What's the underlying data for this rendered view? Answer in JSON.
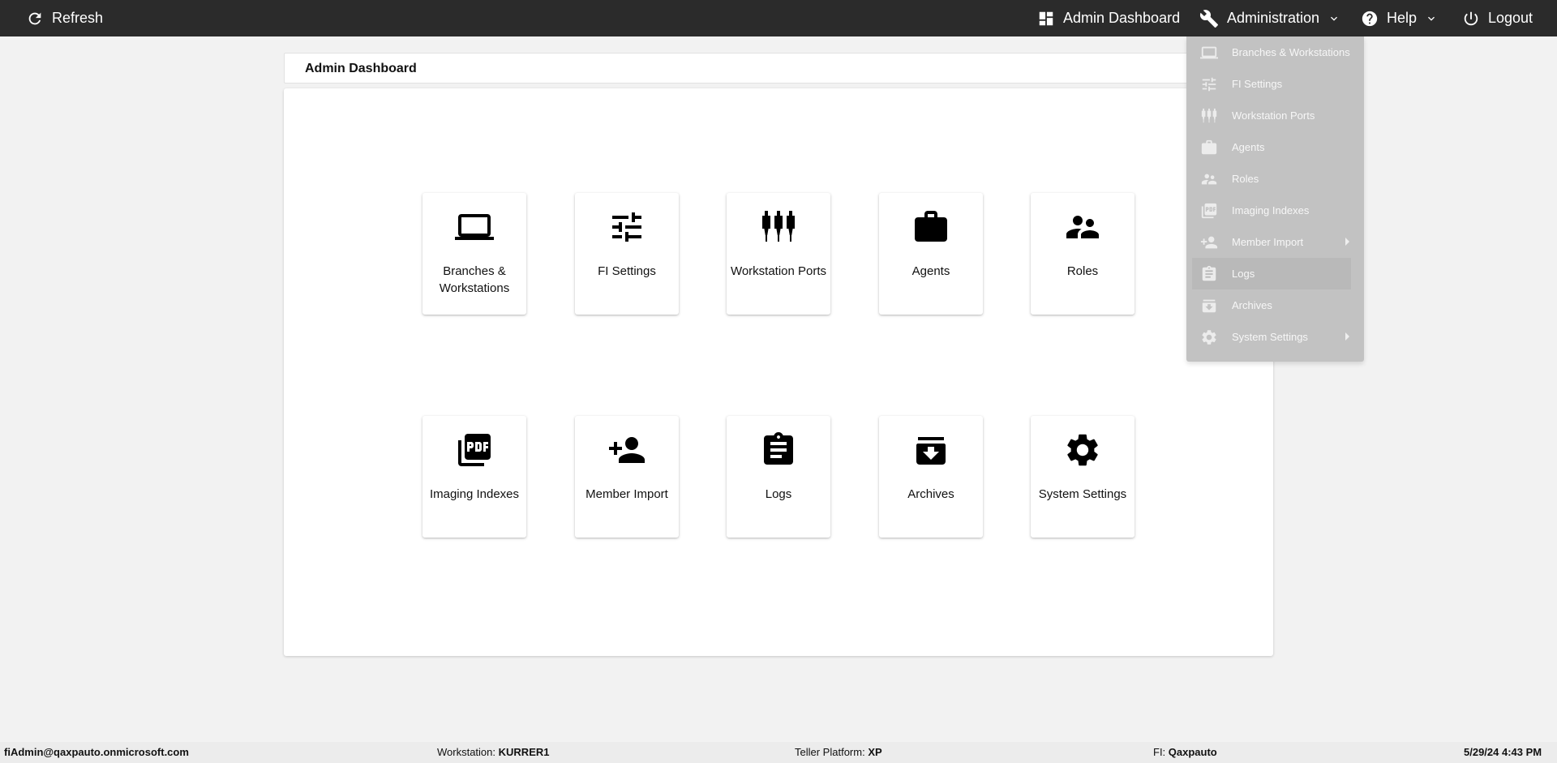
{
  "topbar": {
    "refresh_label": "Refresh",
    "admin_dashboard_label": "Admin Dashboard",
    "administration_label": "Administration",
    "help_label": "Help",
    "logout_label": "Logout"
  },
  "page": {
    "title": "Admin Dashboard"
  },
  "tiles": [
    {
      "label": "Branches & Workstations",
      "icon": "laptop-icon"
    },
    {
      "label": "FI Settings",
      "icon": "tune-icon"
    },
    {
      "label": "Workstation Ports",
      "icon": "ports-icon"
    },
    {
      "label": "Agents",
      "icon": "briefcase-icon"
    },
    {
      "label": "Roles",
      "icon": "people-icon"
    },
    {
      "label": "Imaging Indexes",
      "icon": "pdf-icon"
    },
    {
      "label": "Member Import",
      "icon": "person-add-icon"
    },
    {
      "label": "Logs",
      "icon": "clipboard-icon"
    },
    {
      "label": "Archives",
      "icon": "archive-icon"
    },
    {
      "label": "System Settings",
      "icon": "gear-icon"
    }
  ],
  "dropdown": {
    "items": [
      {
        "label": "Branches & Workstations",
        "icon": "laptop-icon"
      },
      {
        "label": "FI Settings",
        "icon": "tune-icon"
      },
      {
        "label": "Workstation Ports",
        "icon": "ports-icon"
      },
      {
        "label": "Agents",
        "icon": "briefcase-icon"
      },
      {
        "label": "Roles",
        "icon": "people-icon"
      },
      {
        "label": "Imaging Indexes",
        "icon": "pdf-icon"
      },
      {
        "label": "Member Import",
        "icon": "person-add-icon",
        "submenu": true
      },
      {
        "label": "Logs",
        "icon": "clipboard-icon",
        "hovered": true
      },
      {
        "label": "Archives",
        "icon": "archive-icon"
      },
      {
        "label": "System Settings",
        "icon": "gear-icon",
        "submenu": true
      }
    ]
  },
  "status": {
    "user": "fiAdmin@qaxpauto.onmicrosoft.com",
    "workstation_label": "Workstation:",
    "workstation_value": "KURRER1",
    "platform_label": "Teller Platform:",
    "platform_value": "XP",
    "fi_label": "FI:",
    "fi_value": "Qaxpauto",
    "datetime": "5/29/24 4:43 PM"
  },
  "colors": {
    "topbar_bg": "#2b2b2b",
    "page_bg": "#f2f2f2",
    "dropdown_bg": "#c2c2c2"
  }
}
